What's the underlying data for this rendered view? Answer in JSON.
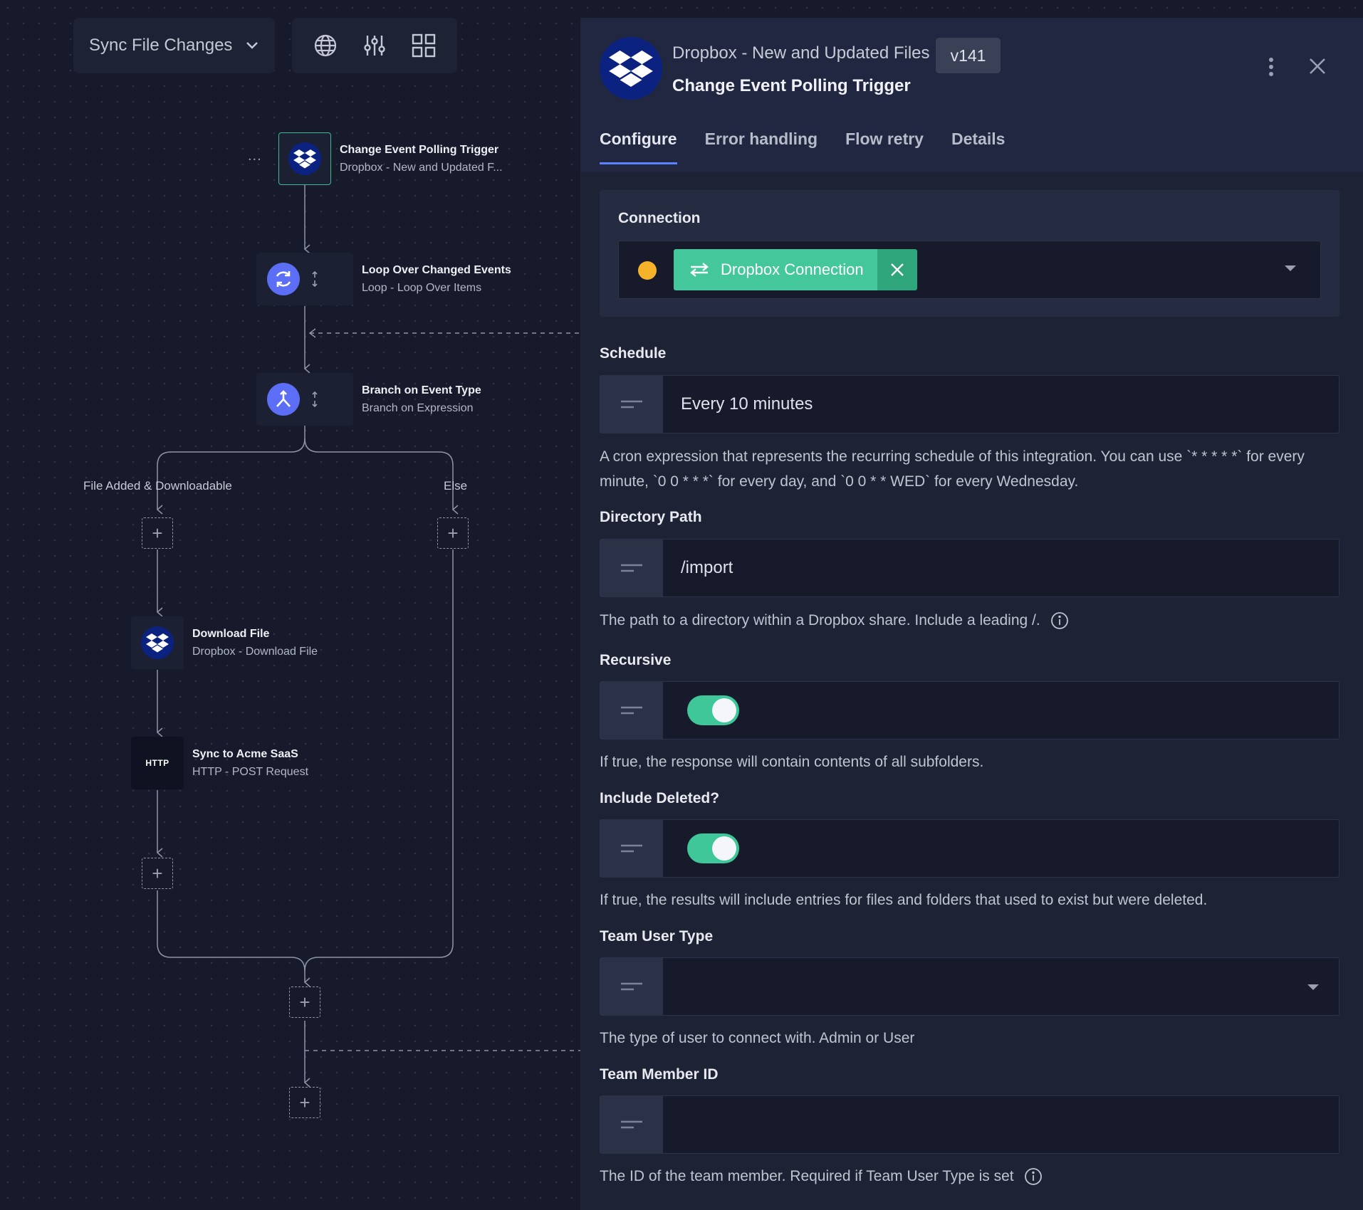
{
  "toolbar": {
    "flow_name": "Sync File Changes",
    "icons": [
      "globe-icon",
      "sliders-icon",
      "grid-icon"
    ]
  },
  "canvas": {
    "nodes": [
      {
        "title": "Change Event Polling Trigger",
        "subtitle": "Dropbox - New and Updated F...",
        "icon": "dropbox-icon"
      },
      {
        "title": "Loop Over Changed Events",
        "subtitle": "Loop - Loop Over Items",
        "icon": "loop-icon"
      },
      {
        "title": "Branch on Event Type",
        "subtitle": "Branch on Expression",
        "icon": "branch-icon"
      },
      {
        "title": "Download File",
        "subtitle": "Dropbox - Download File",
        "icon": "dropbox-icon"
      },
      {
        "title": "Sync to Acme SaaS",
        "subtitle": "HTTP - POST Request",
        "icon": "http-icon",
        "icon_text": "HTTP"
      }
    ],
    "branch_labels": [
      "File Added & Downloadable",
      "Else"
    ],
    "more_label": "...",
    "plus_label": "+"
  },
  "panel": {
    "header": {
      "title": "Dropbox - New and Updated Files",
      "version": "v141",
      "subtitle": "Change Event Polling Trigger"
    },
    "tabs": [
      "Configure",
      "Error handling",
      "Flow retry",
      "Details"
    ],
    "active_tab": "Configure",
    "connection": {
      "label": "Connection",
      "status_color": "#f5b32a",
      "value": "Dropbox Connection"
    },
    "fields": {
      "schedule": {
        "label": "Schedule",
        "value": "Every 10 minutes",
        "description": "A cron expression that represents the recurring schedule of this integration. You can use `* * * * *` for every minute, `0 0 * * *` for every day, and `0 0 * * WED` for every Wednesday."
      },
      "directory_path": {
        "label": "Directory Path",
        "value": "/import",
        "description": "The path to a directory within a Dropbox share. Include a leading /."
      },
      "recursive": {
        "label": "Recursive",
        "value": true,
        "description": "If true, the response will contain contents of all subfolders."
      },
      "include_deleted": {
        "label": "Include Deleted?",
        "value": true,
        "description": "If true, the results will include entries for files and folders that used to exist but were deleted."
      },
      "team_user_type": {
        "label": "Team User Type",
        "value": "",
        "description": "The type of user to connect with. Admin or User"
      },
      "team_member_id": {
        "label": "Team Member ID",
        "value": "",
        "description": "The ID of the team member. Required if Team User Type is set"
      }
    }
  },
  "colors": {
    "accent": "#5b83ff",
    "toggle_on": "#3fc699",
    "connection_chip": "#44c79a",
    "dropbox_blue": "#0c2280",
    "node_icon_purple": "#5b6ef5"
  }
}
